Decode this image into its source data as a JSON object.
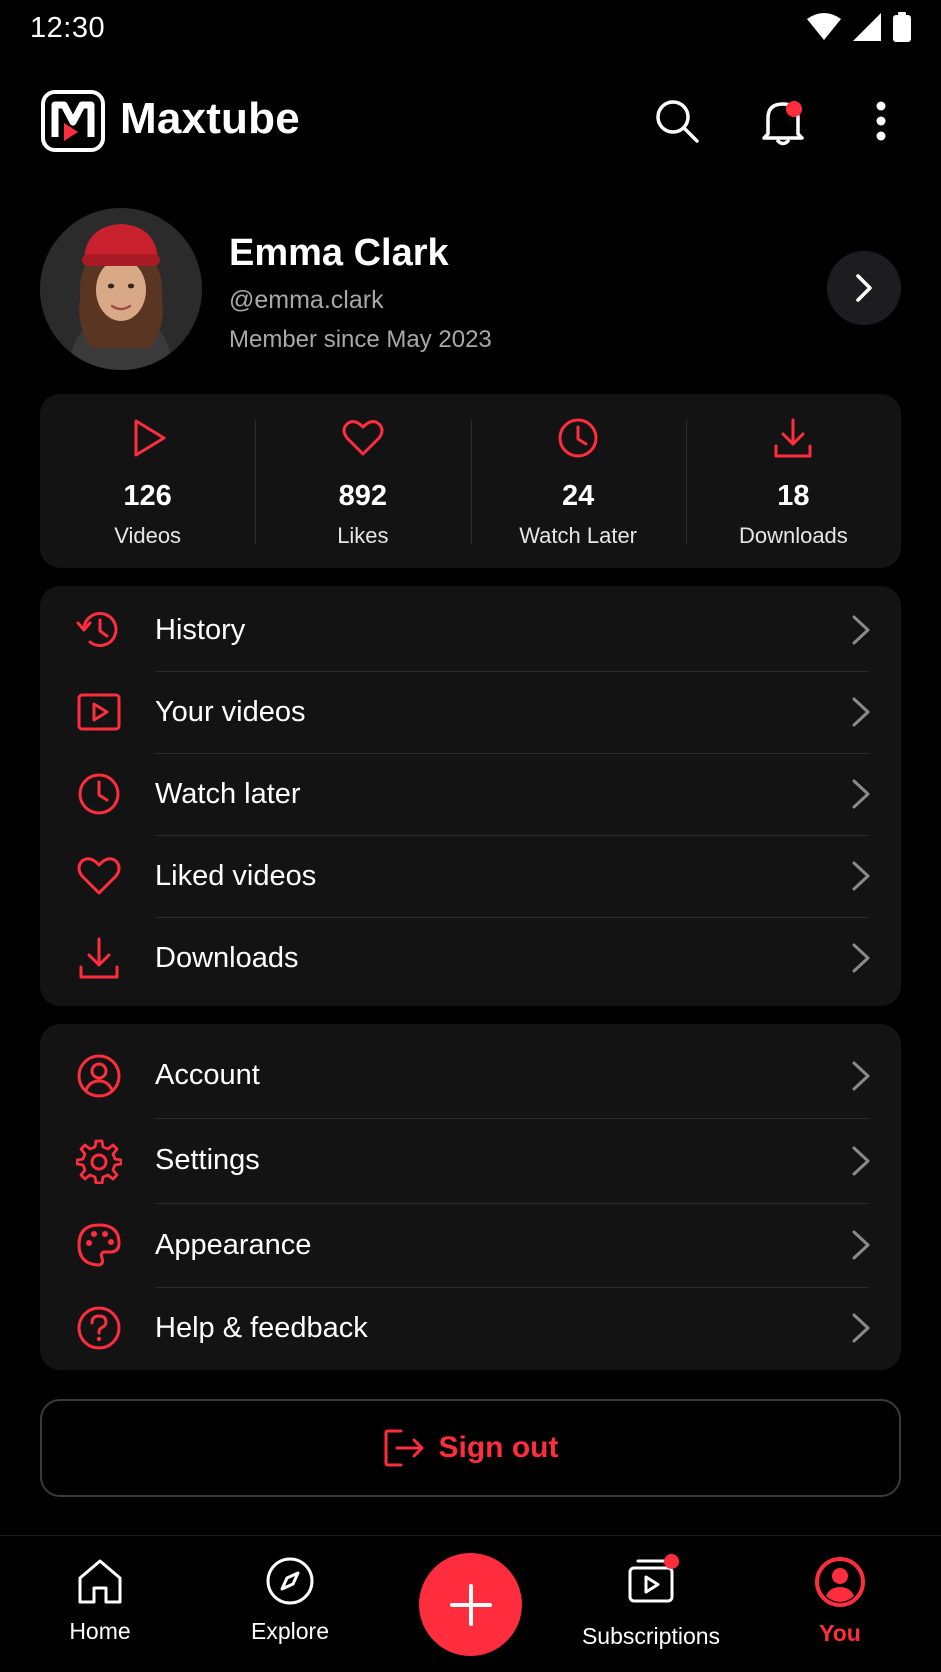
{
  "status_bar": {
    "time": "12:30"
  },
  "app": {
    "title": "Maxtube",
    "logo_letter": "M"
  },
  "profile": {
    "name": "Emma Clark",
    "handle": "@emma.clark",
    "member_since": "Member since May 2023"
  },
  "stats": [
    {
      "icon": "play-icon",
      "value": "126",
      "label": "Videos"
    },
    {
      "icon": "heart-icon",
      "value": "892",
      "label": "Likes"
    },
    {
      "icon": "clock-icon",
      "value": "24",
      "label": "Watch Later"
    },
    {
      "icon": "download-icon",
      "value": "18",
      "label": "Downloads"
    }
  ],
  "library_menu": [
    {
      "icon": "history-icon",
      "label": "History"
    },
    {
      "icon": "video-icon",
      "label": "Your videos"
    },
    {
      "icon": "clock-icon",
      "label": "Watch later"
    },
    {
      "icon": "heart-icon",
      "label": "Liked videos"
    },
    {
      "icon": "download-icon",
      "label": "Downloads"
    }
  ],
  "settings_menu": [
    {
      "icon": "account-icon",
      "label": "Account"
    },
    {
      "icon": "gear-icon",
      "label": "Settings"
    },
    {
      "icon": "palette-icon",
      "label": "Appearance"
    },
    {
      "icon": "help-icon",
      "label": "Help & feedback"
    }
  ],
  "sign_out": {
    "label": "Sign out",
    "icon": "logout-icon"
  },
  "bottom_nav": {
    "home": "Home",
    "explore": "Explore",
    "create_icon": "plus-icon",
    "subscriptions": "Subscriptions",
    "you": "You",
    "active": "You"
  },
  "colors": {
    "accent": "#ff2d3d",
    "background": "#000000",
    "card": "#131313",
    "muted_text": "#a8a8a8"
  }
}
